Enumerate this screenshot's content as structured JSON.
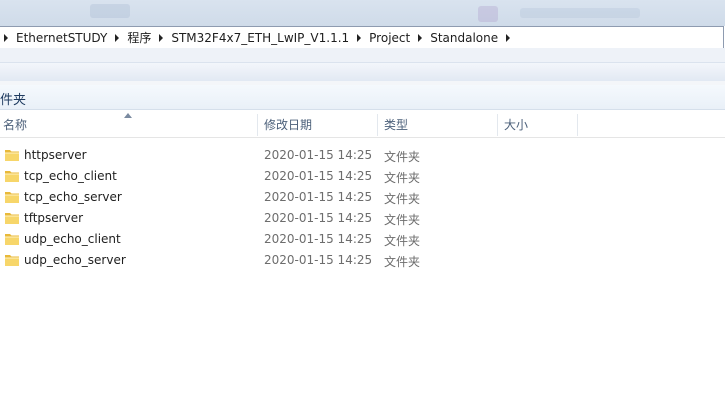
{
  "breadcrumb": [
    {
      "label": "EthernetSTUDY"
    },
    {
      "label": "程序"
    },
    {
      "label": "STM32F4x7_ETH_LwIP_V1.1.1"
    },
    {
      "label": "Project"
    },
    {
      "label": "Standalone"
    }
  ],
  "library_header": "件夹",
  "columns": {
    "name": "名称",
    "date": "修改日期",
    "type": "类型",
    "size": "大小"
  },
  "files": [
    {
      "name": "httpserver",
      "date": "2020-01-15 14:25",
      "type": "文件夹"
    },
    {
      "name": "tcp_echo_client",
      "date": "2020-01-15 14:25",
      "type": "文件夹"
    },
    {
      "name": "tcp_echo_server",
      "date": "2020-01-15 14:25",
      "type": "文件夹"
    },
    {
      "name": "tftpserver",
      "date": "2020-01-15 14:25",
      "type": "文件夹"
    },
    {
      "name": "udp_echo_client",
      "date": "2020-01-15 14:25",
      "type": "文件夹"
    },
    {
      "name": "udp_echo_server",
      "date": "2020-01-15 14:25",
      "type": "文件夹"
    }
  ],
  "colors": {
    "folder_fill": "#f2c94c",
    "header_text": "#4c607a"
  },
  "icons": {
    "folder": "folder-icon",
    "separator": "chevron-right-icon",
    "sort": "sort-caret-icon"
  }
}
